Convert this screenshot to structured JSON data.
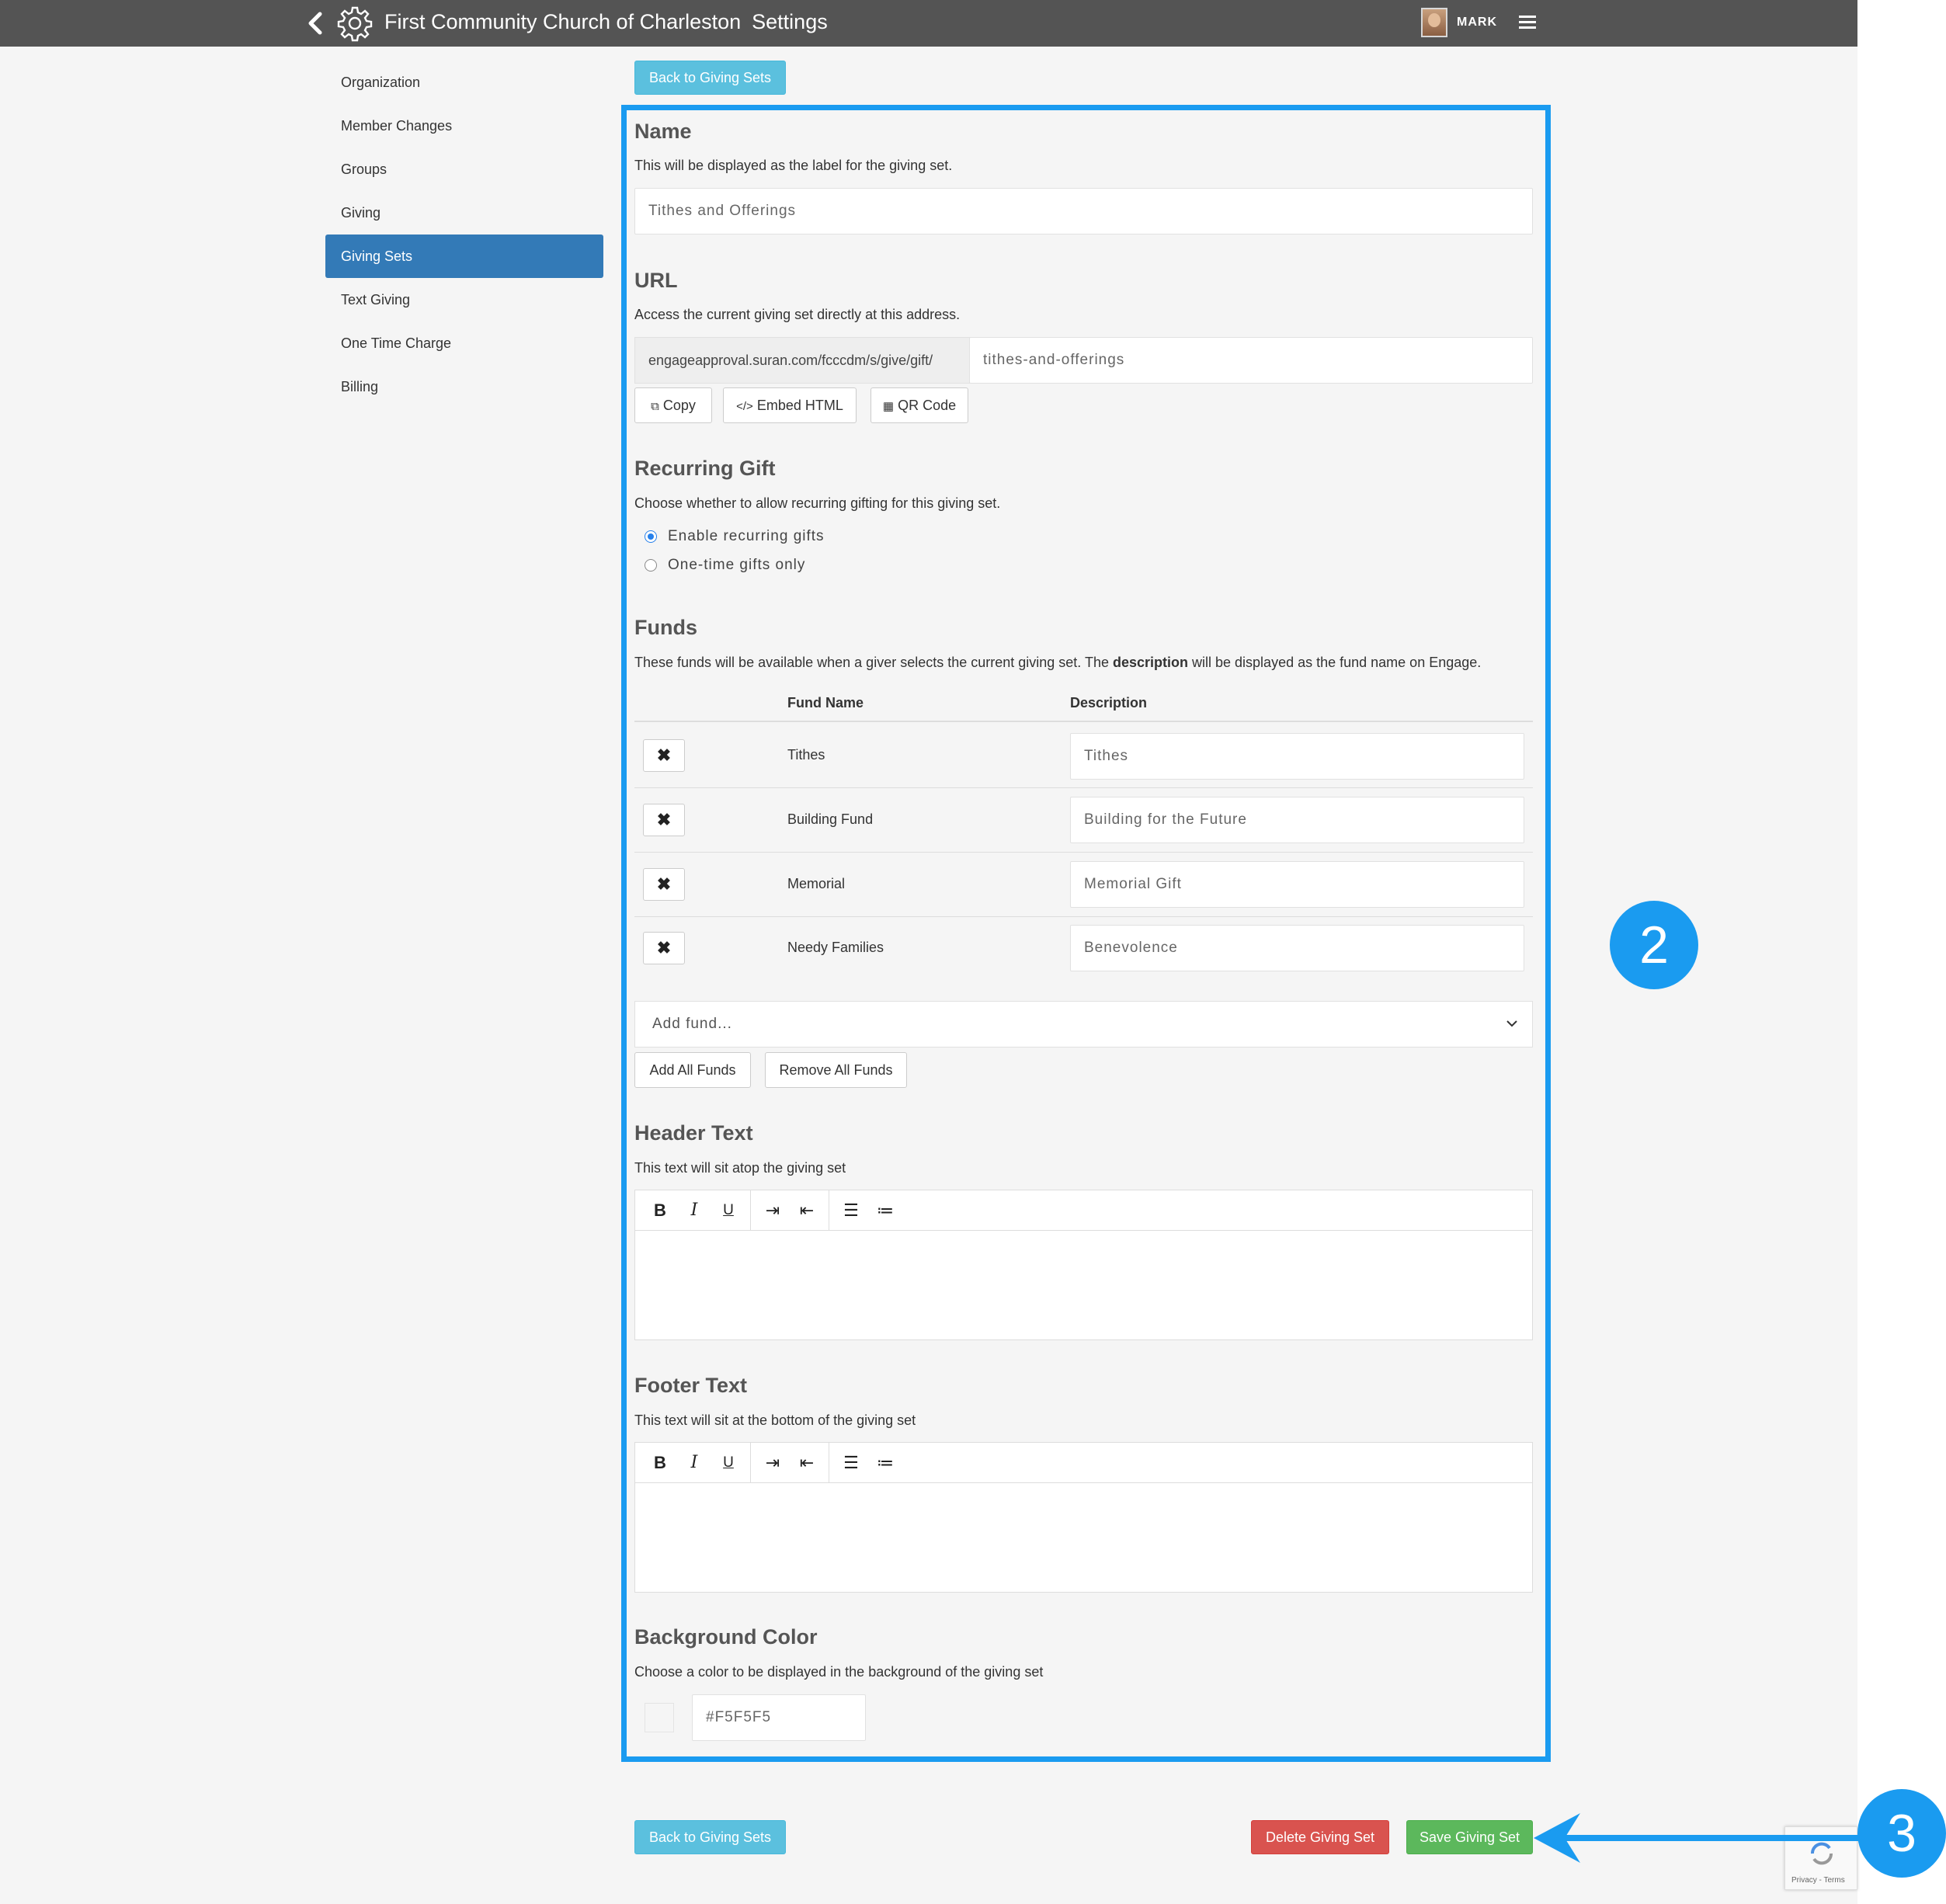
{
  "header": {
    "org_name": "First Community Church of Charleston",
    "section": "Settings",
    "user": "MARK"
  },
  "sidebar": {
    "items": [
      {
        "label": "Organization"
      },
      {
        "label": "Member Changes"
      },
      {
        "label": "Groups"
      },
      {
        "label": "Giving"
      },
      {
        "label": "Giving Sets",
        "active": true
      },
      {
        "label": "Text Giving"
      },
      {
        "label": "One Time Charge"
      },
      {
        "label": "Billing"
      }
    ]
  },
  "actions": {
    "back": "Back to Giving Sets",
    "delete": "Delete Giving Set",
    "save": "Save Giving Set"
  },
  "name_section": {
    "title": "Name",
    "help": "This will be displayed as the label for the giving set.",
    "value": "Tithes and Offerings"
  },
  "url_section": {
    "title": "URL",
    "help": "Access the current giving set directly at this address.",
    "prefix": "engageapproval.suran.com/fcccdm/s/give/gift/",
    "slug": "tithes-and-offerings",
    "copy": "Copy",
    "embed": "Embed HTML",
    "qr": "QR Code"
  },
  "recurring_section": {
    "title": "Recurring Gift",
    "help": "Choose whether to allow recurring gifting for this giving set.",
    "options": [
      {
        "label": "Enable recurring gifts",
        "selected": true
      },
      {
        "label": "One-time gifts only",
        "selected": false
      }
    ]
  },
  "funds_section": {
    "title": "Funds",
    "help_before": "These funds will be available when a giver selects the current giving set. The ",
    "help_bold": "description",
    "help_after": " will be displayed as the fund name on Engage.",
    "col_name": "Fund Name",
    "col_desc": "Description",
    "rows": [
      {
        "name": "Tithes",
        "description": "Tithes"
      },
      {
        "name": "Building Fund",
        "description": "Building for the Future"
      },
      {
        "name": "Memorial",
        "description": "Memorial Gift"
      },
      {
        "name": "Needy Families",
        "description": "Benevolence"
      }
    ],
    "add_placeholder": "Add fund...",
    "add_all": "Add All Funds",
    "remove_all": "Remove All Funds"
  },
  "header_text_section": {
    "title": "Header Text",
    "help": "This text will sit atop the giving set"
  },
  "footer_text_section": {
    "title": "Footer Text",
    "help": "This text will sit at the bottom of the giving set"
  },
  "bg_section": {
    "title": "Background Color",
    "help": "Choose a color to be displayed in the background of the giving set",
    "value": "#F5F5F5"
  },
  "editor_toolbar": {
    "bold": "B",
    "italic": "I",
    "underline": "U"
  },
  "annotations": {
    "step2": "2",
    "step3": "3"
  },
  "recaptcha": {
    "text": "Privacy - Terms"
  },
  "colors": {
    "accent": "#1a9bf0",
    "sidebar_active": "#337ab7",
    "info": "#5bc0de",
    "danger": "#d9534f",
    "success": "#5cb85c"
  }
}
